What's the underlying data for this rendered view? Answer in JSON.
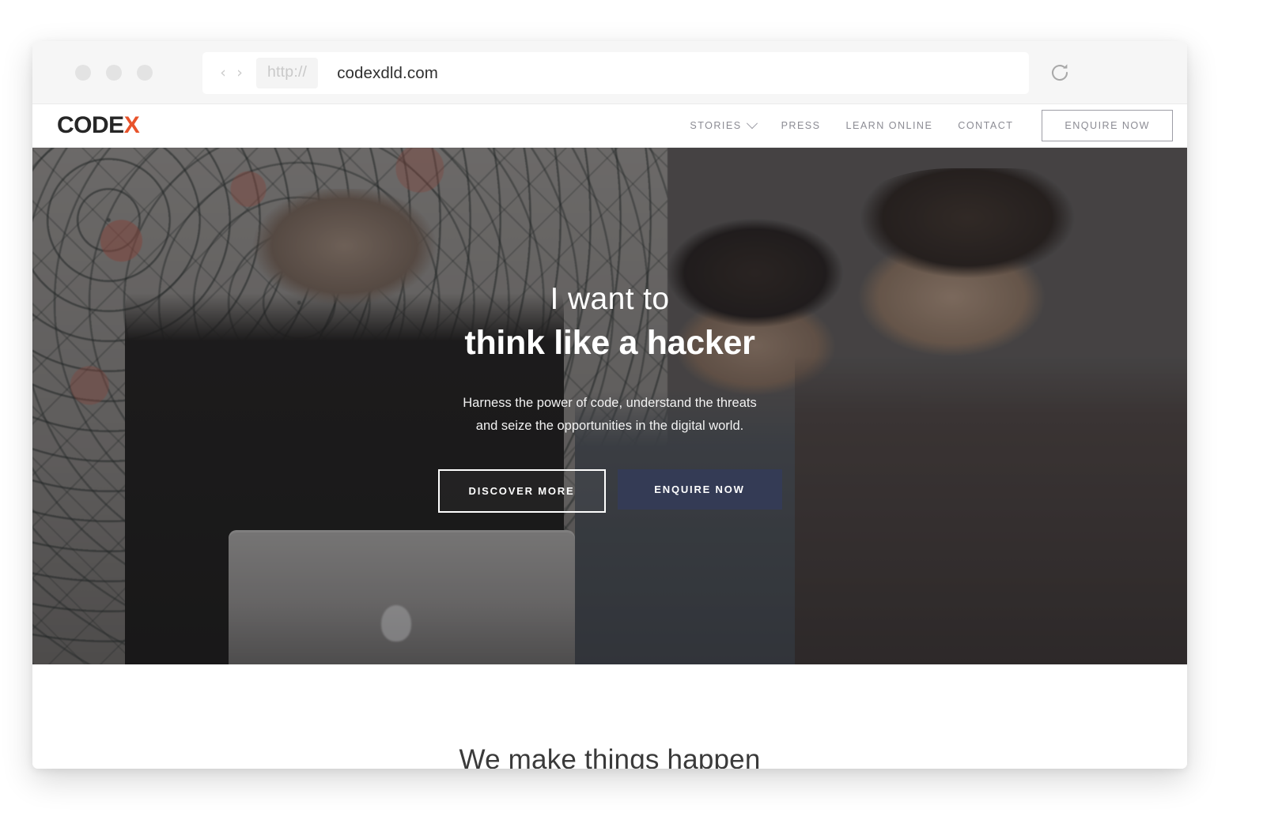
{
  "browser": {
    "url": "codexdld.com",
    "scheme_pill": "http://",
    "back_arrow": "‹",
    "forward_arrow": "›",
    "reload_icon": "reload-icon",
    "traffic_lights": [
      "close-dot",
      "minimize-dot",
      "maximize-dot"
    ]
  },
  "site": {
    "logo": {
      "primary": "CODE",
      "accent": "X",
      "accent_color": "#e8532b",
      "primary_color": "#262626"
    },
    "nav": [
      {
        "label": "STORIES",
        "has_dropdown": true
      },
      {
        "label": "PRESS",
        "has_dropdown": false
      },
      {
        "label": "LEARN ONLINE",
        "has_dropdown": false
      },
      {
        "label": "CONTACT",
        "has_dropdown": false
      }
    ],
    "nav_cta": "ENQUIRE NOW"
  },
  "hero": {
    "kicker": "I want to",
    "title": "think like a hacker",
    "subtitle_line1": "Harness the power of code, understand the threats",
    "subtitle_line2": "and seize the opportunities in the digital world.",
    "cta_primary": "DISCOVER MORE",
    "cta_secondary": "ENQUIRE NOW",
    "cta_secondary_color": "#343b55",
    "overlay_color": "rgba(40,40,44,0.46)"
  },
  "section_make": {
    "title": "We make things happen"
  }
}
